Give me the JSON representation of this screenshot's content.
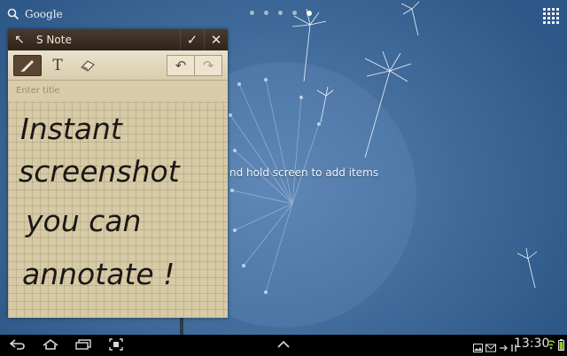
{
  "home": {
    "search_label": "Google",
    "hint_text": "nd hold screen to add items",
    "page_count": 5,
    "active_page": 5
  },
  "snote": {
    "app_title": "S Note",
    "title_placeholder": "Enter title",
    "handwriting": [
      "Instant",
      "screenshot",
      "you  can",
      "annotate !"
    ],
    "tools": [
      "pen-icon",
      "text-icon",
      "eraser-icon"
    ],
    "selected_tool": "pen-icon"
  },
  "statusbar": {
    "time": "13:30"
  },
  "colors": {
    "wallpaper": "#46709f",
    "note_paper": "#d7caa6",
    "note_header": "#3a2d22"
  }
}
